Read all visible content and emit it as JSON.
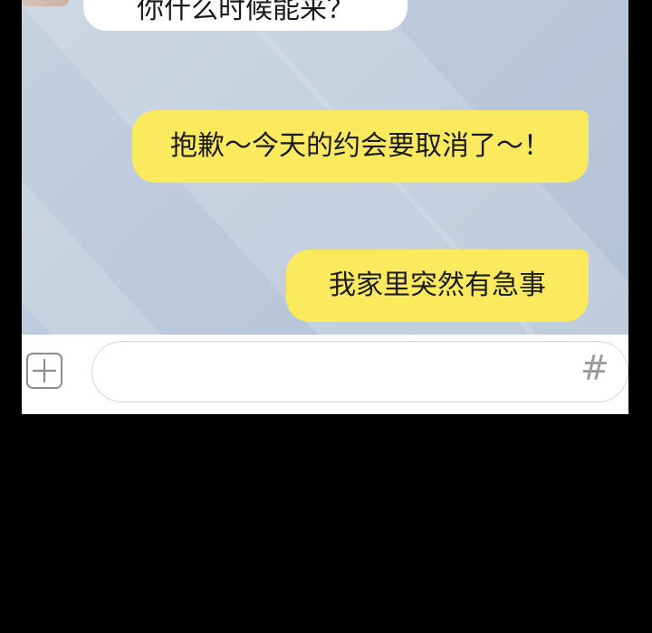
{
  "chat": {
    "messages": [
      {
        "sender": "other",
        "text": "你什么时候能来？"
      },
      {
        "sender": "self",
        "text": "抱歉～今天的约会要取消了～！"
      },
      {
        "sender": "self",
        "text": "我家里突然有急事"
      }
    ]
  },
  "input_bar": {
    "message_value": "",
    "plus_icon": "plus-square-icon",
    "hash_icon": "hash-icon",
    "hash_glyph": "#"
  },
  "colors": {
    "page_background": "#000000",
    "chat_background": "#bccadb",
    "self_bubble": "#fbea5e",
    "other_bubble": "#ffffff",
    "input_bar": "#ffffff"
  }
}
